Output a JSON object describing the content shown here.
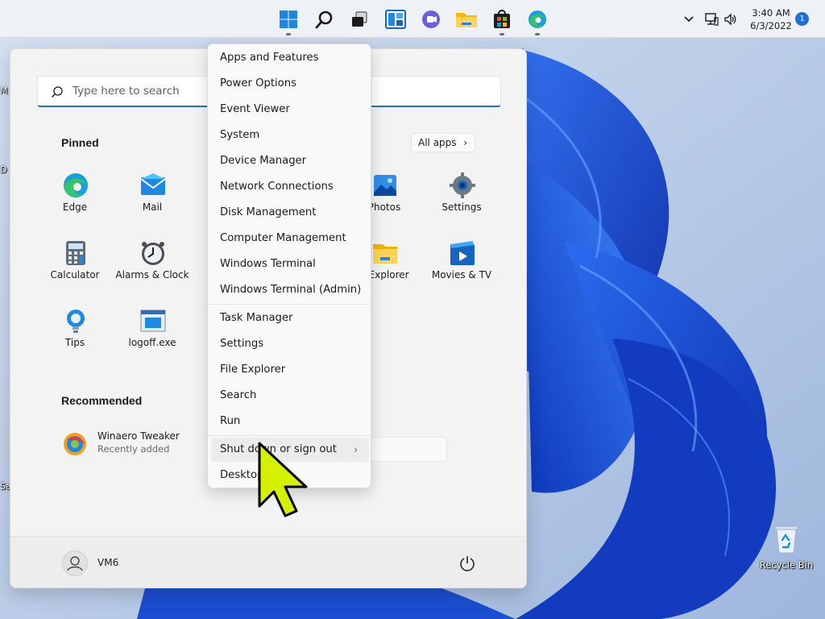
{
  "taskbar": {
    "icons": [
      "windows-start-icon",
      "search-icon",
      "task-view-icon",
      "widgets-icon",
      "chat-icon",
      "file-explorer-icon",
      "store-icon",
      "edge-icon"
    ],
    "tray": {
      "icons": [
        "chevron-up-icon",
        "network-icon",
        "volume-icon"
      ],
      "time": "3:40 AM",
      "date": "6/3/2022",
      "notifications": "1"
    }
  },
  "start_menu": {
    "search_placeholder": "Type here to search",
    "pinned_title": "Pinned",
    "all_apps_label": "All apps",
    "all_apps_chevron": "›",
    "pinned_apps": [
      {
        "label": "Edge",
        "icon": "edge-icon"
      },
      {
        "label": "Mail",
        "icon": "mail-icon"
      },
      {
        "label": "Photos",
        "icon": "photos-icon"
      },
      {
        "label": "Settings",
        "icon": "settings-icon"
      },
      {
        "label": "Calculator",
        "icon": "calculator-icon"
      },
      {
        "label": "Alarms & Clock",
        "icon": "clock-icon"
      },
      {
        "label": "e Explorer",
        "icon": "file-explorer-icon"
      },
      {
        "label": "Movies & TV",
        "icon": "movies-icon"
      },
      {
        "label": "Tips",
        "icon": "tips-icon"
      },
      {
        "label": "logoff.exe",
        "icon": "exe-icon"
      }
    ],
    "recommended_title": "Recommended",
    "recommended": [
      {
        "name": "Winaero Tweaker",
        "sub": "Recently added",
        "icon": "winaero-icon"
      }
    ],
    "user_name": "VM6",
    "power_icon": "power-icon"
  },
  "context_menu": {
    "groups": [
      [
        "Apps and Features",
        "Power Options",
        "Event Viewer",
        "System",
        "Device Manager",
        "Network Connections",
        "Disk Management",
        "Computer Management",
        "Windows Terminal",
        "Windows Terminal (Admin)"
      ],
      [
        "Task Manager",
        "Settings",
        "File Explorer",
        "Search",
        "Run"
      ],
      [
        "Shut down or sign out",
        "Desktop"
      ]
    ],
    "submenu_chevron": "›"
  },
  "desktop": {
    "recycle_bin_label": "Recycle Bin",
    "edge_letters": [
      "M",
      "D",
      "Sa"
    ]
  },
  "colors": {
    "accent": "#1f6fd6",
    "cursor": "#d5f000",
    "wallpaper_sky": "#b7cbe6",
    "wallpaper_bloom": "#1845c4"
  }
}
